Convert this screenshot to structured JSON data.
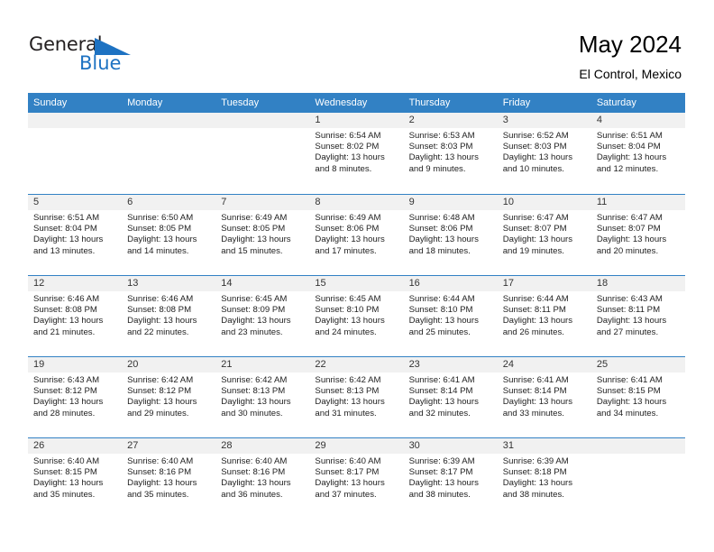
{
  "brand": {
    "name_top": "General",
    "name_bottom": "Blue",
    "accent_color": "#1d72c2"
  },
  "header": {
    "title": "May 2024",
    "subtitle": "El Control, Mexico"
  },
  "theme": {
    "header_bar_color": "#3281c4",
    "daynum_band_color": "#f1f1f1",
    "text_color": "#222222"
  },
  "weekdays": [
    "Sunday",
    "Monday",
    "Tuesday",
    "Wednesday",
    "Thursday",
    "Friday",
    "Saturday"
  ],
  "weeks": [
    [
      {
        "day": "",
        "empty": true
      },
      {
        "day": "",
        "empty": true
      },
      {
        "day": "",
        "empty": true
      },
      {
        "day": "1",
        "sunrise": "Sunrise: 6:54 AM",
        "sunset": "Sunset: 8:02 PM",
        "daylight": "Daylight: 13 hours and 8 minutes."
      },
      {
        "day": "2",
        "sunrise": "Sunrise: 6:53 AM",
        "sunset": "Sunset: 8:03 PM",
        "daylight": "Daylight: 13 hours and 9 minutes."
      },
      {
        "day": "3",
        "sunrise": "Sunrise: 6:52 AM",
        "sunset": "Sunset: 8:03 PM",
        "daylight": "Daylight: 13 hours and 10 minutes."
      },
      {
        "day": "4",
        "sunrise": "Sunrise: 6:51 AM",
        "sunset": "Sunset: 8:04 PM",
        "daylight": "Daylight: 13 hours and 12 minutes."
      }
    ],
    [
      {
        "day": "5",
        "sunrise": "Sunrise: 6:51 AM",
        "sunset": "Sunset: 8:04 PM",
        "daylight": "Daylight: 13 hours and 13 minutes."
      },
      {
        "day": "6",
        "sunrise": "Sunrise: 6:50 AM",
        "sunset": "Sunset: 8:05 PM",
        "daylight": "Daylight: 13 hours and 14 minutes."
      },
      {
        "day": "7",
        "sunrise": "Sunrise: 6:49 AM",
        "sunset": "Sunset: 8:05 PM",
        "daylight": "Daylight: 13 hours and 15 minutes."
      },
      {
        "day": "8",
        "sunrise": "Sunrise: 6:49 AM",
        "sunset": "Sunset: 8:06 PM",
        "daylight": "Daylight: 13 hours and 17 minutes."
      },
      {
        "day": "9",
        "sunrise": "Sunrise: 6:48 AM",
        "sunset": "Sunset: 8:06 PM",
        "daylight": "Daylight: 13 hours and 18 minutes."
      },
      {
        "day": "10",
        "sunrise": "Sunrise: 6:47 AM",
        "sunset": "Sunset: 8:07 PM",
        "daylight": "Daylight: 13 hours and 19 minutes."
      },
      {
        "day": "11",
        "sunrise": "Sunrise: 6:47 AM",
        "sunset": "Sunset: 8:07 PM",
        "daylight": "Daylight: 13 hours and 20 minutes."
      }
    ],
    [
      {
        "day": "12",
        "sunrise": "Sunrise: 6:46 AM",
        "sunset": "Sunset: 8:08 PM",
        "daylight": "Daylight: 13 hours and 21 minutes."
      },
      {
        "day": "13",
        "sunrise": "Sunrise: 6:46 AM",
        "sunset": "Sunset: 8:08 PM",
        "daylight": "Daylight: 13 hours and 22 minutes."
      },
      {
        "day": "14",
        "sunrise": "Sunrise: 6:45 AM",
        "sunset": "Sunset: 8:09 PM",
        "daylight": "Daylight: 13 hours and 23 minutes."
      },
      {
        "day": "15",
        "sunrise": "Sunrise: 6:45 AM",
        "sunset": "Sunset: 8:10 PM",
        "daylight": "Daylight: 13 hours and 24 minutes."
      },
      {
        "day": "16",
        "sunrise": "Sunrise: 6:44 AM",
        "sunset": "Sunset: 8:10 PM",
        "daylight": "Daylight: 13 hours and 25 minutes."
      },
      {
        "day": "17",
        "sunrise": "Sunrise: 6:44 AM",
        "sunset": "Sunset: 8:11 PM",
        "daylight": "Daylight: 13 hours and 26 minutes."
      },
      {
        "day": "18",
        "sunrise": "Sunrise: 6:43 AM",
        "sunset": "Sunset: 8:11 PM",
        "daylight": "Daylight: 13 hours and 27 minutes."
      }
    ],
    [
      {
        "day": "19",
        "sunrise": "Sunrise: 6:43 AM",
        "sunset": "Sunset: 8:12 PM",
        "daylight": "Daylight: 13 hours and 28 minutes."
      },
      {
        "day": "20",
        "sunrise": "Sunrise: 6:42 AM",
        "sunset": "Sunset: 8:12 PM",
        "daylight": "Daylight: 13 hours and 29 minutes."
      },
      {
        "day": "21",
        "sunrise": "Sunrise: 6:42 AM",
        "sunset": "Sunset: 8:13 PM",
        "daylight": "Daylight: 13 hours and 30 minutes."
      },
      {
        "day": "22",
        "sunrise": "Sunrise: 6:42 AM",
        "sunset": "Sunset: 8:13 PM",
        "daylight": "Daylight: 13 hours and 31 minutes."
      },
      {
        "day": "23",
        "sunrise": "Sunrise: 6:41 AM",
        "sunset": "Sunset: 8:14 PM",
        "daylight": "Daylight: 13 hours and 32 minutes."
      },
      {
        "day": "24",
        "sunrise": "Sunrise: 6:41 AM",
        "sunset": "Sunset: 8:14 PM",
        "daylight": "Daylight: 13 hours and 33 minutes."
      },
      {
        "day": "25",
        "sunrise": "Sunrise: 6:41 AM",
        "sunset": "Sunset: 8:15 PM",
        "daylight": "Daylight: 13 hours and 34 minutes."
      }
    ],
    [
      {
        "day": "26",
        "sunrise": "Sunrise: 6:40 AM",
        "sunset": "Sunset: 8:15 PM",
        "daylight": "Daylight: 13 hours and 35 minutes."
      },
      {
        "day": "27",
        "sunrise": "Sunrise: 6:40 AM",
        "sunset": "Sunset: 8:16 PM",
        "daylight": "Daylight: 13 hours and 35 minutes."
      },
      {
        "day": "28",
        "sunrise": "Sunrise: 6:40 AM",
        "sunset": "Sunset: 8:16 PM",
        "daylight": "Daylight: 13 hours and 36 minutes."
      },
      {
        "day": "29",
        "sunrise": "Sunrise: 6:40 AM",
        "sunset": "Sunset: 8:17 PM",
        "daylight": "Daylight: 13 hours and 37 minutes."
      },
      {
        "day": "30",
        "sunrise": "Sunrise: 6:39 AM",
        "sunset": "Sunset: 8:17 PM",
        "daylight": "Daylight: 13 hours and 38 minutes."
      },
      {
        "day": "31",
        "sunrise": "Sunrise: 6:39 AM",
        "sunset": "Sunset: 8:18 PM",
        "daylight": "Daylight: 13 hours and 38 minutes."
      },
      {
        "day": "",
        "empty": true
      }
    ]
  ]
}
